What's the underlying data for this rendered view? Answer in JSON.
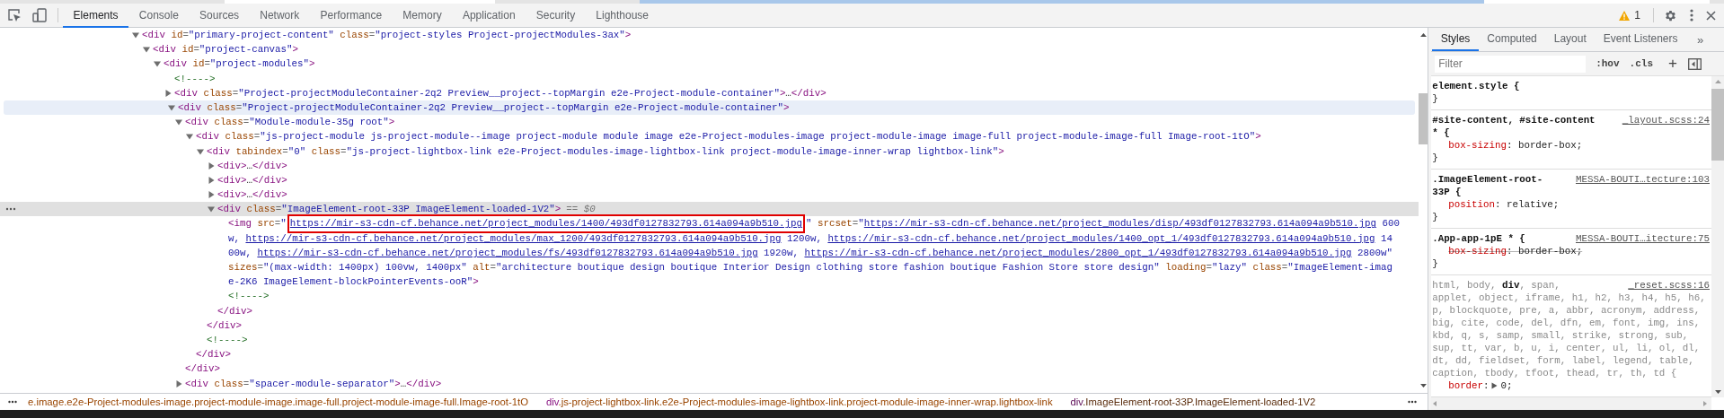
{
  "toolbar": {
    "tabs": [
      {
        "label": "Elements",
        "selected": true
      },
      {
        "label": "Console",
        "selected": false
      },
      {
        "label": "Sources",
        "selected": false
      },
      {
        "label": "Network",
        "selected": false
      },
      {
        "label": "Performance",
        "selected": false
      },
      {
        "label": "Memory",
        "selected": false
      },
      {
        "label": "Application",
        "selected": false
      },
      {
        "label": "Security",
        "selected": false
      },
      {
        "label": "Lighthouse",
        "selected": false
      }
    ],
    "warnings": {
      "count": "1"
    }
  },
  "elements_tree": [
    {
      "kind": "element",
      "expanded": true,
      "selected": false,
      "hovered": false,
      "open": [
        [
          {
            "kind": "tag",
            "text": "<div"
          },
          {
            "kind": "attr",
            "text": " id"
          },
          {
            "kind": "punct",
            "text": "="
          },
          {
            "kind": "value",
            "text": "\"primary-project-content\""
          },
          {
            "kind": "attr",
            "text": " class"
          },
          {
            "kind": "punct",
            "text": "="
          },
          {
            "kind": "value",
            "text": "\"project-styles Project-projectModules-3ax\""
          },
          {
            "kind": "tag",
            "text": ">"
          }
        ]
      ],
      "children": [
        {
          "kind": "element",
          "expanded": true,
          "selected": false,
          "hovered": false,
          "open": [
            [
              {
                "kind": "tag",
                "text": "<div"
              },
              {
                "kind": "attr",
                "text": " id"
              },
              {
                "kind": "punct",
                "text": "="
              },
              {
                "kind": "value",
                "text": "\"project-canvas\""
              },
              {
                "kind": "tag",
                "text": ">"
              }
            ]
          ],
          "children": [
            {
              "kind": "element",
              "expanded": true,
              "selected": false,
              "hovered": false,
              "open": [
                [
                  {
                    "kind": "tag",
                    "text": "<div"
                  },
                  {
                    "kind": "attr",
                    "text": " id"
                  },
                  {
                    "kind": "punct",
                    "text": "="
                  },
                  {
                    "kind": "value",
                    "text": "\"project-modules\""
                  },
                  {
                    "kind": "tag",
                    "text": ">"
                  }
                ]
              ],
              "children": [
                {
                  "kind": "leaf",
                  "selected": false,
                  "hovered": false,
                  "open": [
                    [
                      {
                        "kind": "comment",
                        "text": "<!---->"
                      }
                    ]
                  ]
                },
                {
                  "kind": "element",
                  "expanded": false,
                  "selected": false,
                  "hovered": false,
                  "open": [
                    [
                      {
                        "kind": "tag",
                        "text": "<div"
                      },
                      {
                        "kind": "attr",
                        "text": " class"
                      },
                      {
                        "kind": "punct",
                        "text": "="
                      },
                      {
                        "kind": "value",
                        "text": "\"Project-projectModuleContainer-2q2 Preview__project--topMargin e2e-Project-module-container\""
                      },
                      {
                        "kind": "tag",
                        "text": ">"
                      },
                      {
                        "kind": "text",
                        "text": "…"
                      },
                      {
                        "kind": "tag",
                        "text": "</div>"
                      }
                    ]
                  ]
                },
                {
                  "kind": "element",
                  "expanded": true,
                  "selected": false,
                  "hovered": true,
                  "open": [
                    [
                      {
                        "kind": "tag",
                        "text": "<div"
                      },
                      {
                        "kind": "attr",
                        "text": " class"
                      },
                      {
                        "kind": "punct",
                        "text": "="
                      },
                      {
                        "kind": "value",
                        "text": "\"Project-projectModuleContainer-2q2 Preview__project--topMargin e2e-Project-module-container\""
                      },
                      {
                        "kind": "tag",
                        "text": ">"
                      }
                    ]
                  ],
                  "children": [
                    {
                      "kind": "element",
                      "expanded": true,
                      "selected": false,
                      "hovered": false,
                      "open": [
                        [
                          {
                            "kind": "tag",
                            "text": "<div"
                          },
                          {
                            "kind": "attr",
                            "text": " class"
                          },
                          {
                            "kind": "punct",
                            "text": "="
                          },
                          {
                            "kind": "value",
                            "text": "\"Module-module-35g root\""
                          },
                          {
                            "kind": "tag",
                            "text": ">"
                          }
                        ]
                      ],
                      "close": [
                        {
                          "kind": "tag",
                          "text": "</div>"
                        }
                      ],
                      "children": [
                        {
                          "kind": "element",
                          "expanded": true,
                          "selected": false,
                          "hovered": false,
                          "open": [
                            [
                              {
                                "kind": "tag",
                                "text": "<div"
                              },
                              {
                                "kind": "attr",
                                "text": " class"
                              },
                              {
                                "kind": "punct",
                                "text": "="
                              },
                              {
                                "kind": "value",
                                "text": "\"js-project-module js-project-module--image project-module module image e2e-Project-modules-image project-module-image image-full project-module-image-full Image-root-1tO\""
                              },
                              {
                                "kind": "tag",
                                "text": ">"
                              }
                            ]
                          ],
                          "close": [
                            {
                              "kind": "tag",
                              "text": "</div>"
                            }
                          ],
                          "children": [
                            {
                              "kind": "element",
                              "expanded": true,
                              "selected": false,
                              "hovered": false,
                              "open": [
                                [
                                  {
                                    "kind": "tag",
                                    "text": "<div"
                                  },
                                  {
                                    "kind": "attr",
                                    "text": " tabindex"
                                  },
                                  {
                                    "kind": "punct",
                                    "text": "="
                                  },
                                  {
                                    "kind": "value",
                                    "text": "\"0\""
                                  },
                                  {
                                    "kind": "attr",
                                    "text": " class"
                                  },
                                  {
                                    "kind": "punct",
                                    "text": "="
                                  },
                                  {
                                    "kind": "value",
                                    "text": "\"js-project-lightbox-link e2e-Project-modules-image-lightbox-link project-module-image-inner-wrap lightbox-link\""
                                  },
                                  {
                                    "kind": "tag",
                                    "text": ">"
                                  }
                                ]
                              ],
                              "close": [
                                {
                                  "kind": "tag",
                                  "text": "</div>"
                                }
                              ],
                              "children": [
                                {
                                  "kind": "element",
                                  "expanded": false,
                                  "selected": false,
                                  "hovered": false,
                                  "open": [
                                    [
                                      {
                                        "kind": "tag",
                                        "text": "<div>"
                                      },
                                      {
                                        "kind": "text",
                                        "text": "…"
                                      },
                                      {
                                        "kind": "tag",
                                        "text": "</div>"
                                      }
                                    ]
                                  ]
                                },
                                {
                                  "kind": "element",
                                  "expanded": false,
                                  "selected": false,
                                  "hovered": false,
                                  "open": [
                                    [
                                      {
                                        "kind": "tag",
                                        "text": "<div>"
                                      },
                                      {
                                        "kind": "text",
                                        "text": "…"
                                      },
                                      {
                                        "kind": "tag",
                                        "text": "</div>"
                                      }
                                    ]
                                  ]
                                },
                                {
                                  "kind": "element",
                                  "expanded": false,
                                  "selected": false,
                                  "hovered": false,
                                  "open": [
                                    [
                                      {
                                        "kind": "tag",
                                        "text": "<div>"
                                      },
                                      {
                                        "kind": "text",
                                        "text": "…"
                                      },
                                      {
                                        "kind": "tag",
                                        "text": "</div>"
                                      }
                                    ]
                                  ]
                                },
                                {
                                  "kind": "element",
                                  "expanded": true,
                                  "selected": true,
                                  "hovered": false,
                                  "open": [
                                    [
                                      {
                                        "kind": "tag",
                                        "text": "<div"
                                      },
                                      {
                                        "kind": "attr",
                                        "text": " class"
                                      },
                                      {
                                        "kind": "punct",
                                        "text": "="
                                      },
                                      {
                                        "kind": "value",
                                        "text": "\"ImageElement-root-33P ImageElement-loaded-1V2\""
                                      },
                                      {
                                        "kind": "tag",
                                        "text": ">"
                                      },
                                      {
                                        "kind": "marker",
                                        "text": "== $0"
                                      }
                                    ]
                                  ],
                                  "close": [
                                    {
                                      "kind": "tag",
                                      "text": "</div>"
                                    }
                                  ],
                                  "children": [
                                    {
                                      "kind": "leaf",
                                      "selected": false,
                                      "hovered": false,
                                      "open": [
                                        [
                                          {
                                            "kind": "tag",
                                            "text": "<img"
                                          },
                                          {
                                            "kind": "attr",
                                            "text": " src"
                                          },
                                          {
                                            "kind": "punct",
                                            "text": "="
                                          },
                                          {
                                            "kind": "value",
                                            "text": "\""
                                          },
                                          {
                                            "kind": "link",
                                            "text": "https://mir-s3-cdn-cf.behance.net/project_modules/1400/493df0127832793.614a094a9b510.jpg",
                                            "highlighted": true
                                          },
                                          {
                                            "kind": "value",
                                            "text": "\""
                                          },
                                          {
                                            "kind": "attr",
                                            "text": " srcset"
                                          },
                                          {
                                            "kind": "punct",
                                            "text": "="
                                          },
                                          {
                                            "kind": "value",
                                            "text": "\""
                                          },
                                          {
                                            "kind": "link",
                                            "text": "https://mir-s3-cdn-cf.behance.net/project_modules/disp/493df0127832793.614a094a9b510.jpg",
                                            "highlighted": false
                                          },
                                          {
                                            "kind": "value",
                                            "text": " 600"
                                          }
                                        ],
                                        [
                                          {
                                            "kind": "value",
                                            "text": "w, "
                                          },
                                          {
                                            "kind": "link",
                                            "text": "https://mir-s3-cdn-cf.behance.net/project_modules/max_1200/493df0127832793.614a094a9b510.jpg",
                                            "highlighted": false
                                          },
                                          {
                                            "kind": "value",
                                            "text": " 1200w, "
                                          },
                                          {
                                            "kind": "link",
                                            "text": "https://mir-s3-cdn-cf.behance.net/project_modules/1400_opt_1/493df0127832793.614a094a9b510.jpg",
                                            "highlighted": false
                                          },
                                          {
                                            "kind": "value",
                                            "text": " 14"
                                          }
                                        ],
                                        [
                                          {
                                            "kind": "value",
                                            "text": "00w, "
                                          },
                                          {
                                            "kind": "link",
                                            "text": "https://mir-s3-cdn-cf.behance.net/project_modules/fs/493df0127832793.614a094a9b510.jpg",
                                            "highlighted": false
                                          },
                                          {
                                            "kind": "value",
                                            "text": " 1920w, "
                                          },
                                          {
                                            "kind": "link",
                                            "text": "https://mir-s3-cdn-cf.behance.net/project_modules/2800_opt_1/493df0127832793.614a094a9b510.jpg",
                                            "highlighted": false
                                          },
                                          {
                                            "kind": "value",
                                            "text": " 2800w\""
                                          }
                                        ],
                                        [
                                          {
                                            "kind": "attr",
                                            "text": "sizes"
                                          },
                                          {
                                            "kind": "punct",
                                            "text": "="
                                          },
                                          {
                                            "kind": "value",
                                            "text": "\"(max-width: 1400px) 100vw, 1400px\""
                                          },
                                          {
                                            "kind": "attr",
                                            "text": " alt"
                                          },
                                          {
                                            "kind": "punct",
                                            "text": "="
                                          },
                                          {
                                            "kind": "value",
                                            "text": "\"architecture boutique design boutique Interior Design clothing store fashion boutique Fashion Store store design\""
                                          },
                                          {
                                            "kind": "attr",
                                            "text": " loading"
                                          },
                                          {
                                            "kind": "punct",
                                            "text": "="
                                          },
                                          {
                                            "kind": "value",
                                            "text": "\"lazy\""
                                          },
                                          {
                                            "kind": "attr",
                                            "text": " class"
                                          },
                                          {
                                            "kind": "punct",
                                            "text": "="
                                          },
                                          {
                                            "kind": "value",
                                            "text": "\"ImageElement-imag"
                                          }
                                        ],
                                        [
                                          {
                                            "kind": "value",
                                            "text": "e-2K6 ImageElement-blockPointerEvents-ooR\""
                                          },
                                          {
                                            "kind": "tag",
                                            "text": ">"
                                          }
                                        ]
                                      ]
                                    },
                                    {
                                      "kind": "leaf",
                                      "selected": false,
                                      "hovered": false,
                                      "open": [
                                        [
                                          {
                                            "kind": "comment",
                                            "text": "<!---->"
                                          }
                                        ]
                                      ]
                                    }
                                  ]
                                }
                              ]
                            },
                            {
                              "kind": "leaf",
                              "selected": false,
                              "hovered": false,
                              "open": [
                                [
                                  {
                                    "kind": "comment",
                                    "text": "<!---->"
                                  }
                                ]
                              ]
                            }
                          ]
                        }
                      ]
                    },
                    {
                      "kind": "element",
                      "expanded": false,
                      "selected": false,
                      "hovered": false,
                      "open": [
                        [
                          {
                            "kind": "tag",
                            "text": "<div"
                          },
                          {
                            "kind": "attr",
                            "text": " class"
                          },
                          {
                            "kind": "punct",
                            "text": "="
                          },
                          {
                            "kind": "value",
                            "text": "\"spacer-module-separator\""
                          },
                          {
                            "kind": "tag",
                            "text": ">"
                          },
                          {
                            "kind": "text",
                            "text": "…"
                          },
                          {
                            "kind": "tag",
                            "text": "</div>"
                          }
                        ]
                      ]
                    }
                  ]
                }
              ]
            }
          ]
        }
      ]
    }
  ],
  "breadcrumbs": [
    {
      "classes": "e.image.e2e-Project-modules-image.project-module-image.image-full.project-module-image-full.Image-root-1tO",
      "selected": false
    },
    {
      "tag": "div",
      "classes": ".js-project-lightbox-link.e2e-Project-modules-image-lightbox-link.project-module-image-inner-wrap.lightbox-link",
      "selected": false
    },
    {
      "tag": "div",
      "classes": ".ImageElement-root-33P.ImageElement-loaded-1V2",
      "selected": true
    }
  ],
  "styles_panel": {
    "tabs": [
      {
        "label": "Styles",
        "selected": true
      },
      {
        "label": "Computed",
        "selected": false
      },
      {
        "label": "Layout",
        "selected": false
      },
      {
        "label": "Event Listeners",
        "selected": false
      }
    ],
    "more_tabs": "»",
    "filter": {
      "placeholder": "Filter"
    },
    "hov": ":hov",
    "cls": ".cls",
    "add": "+",
    "rules": [
      {
        "selector": [
          [
            {
              "text": "element.style {",
              "matched": true
            }
          ]
        ],
        "close": "}"
      },
      {
        "selector": [
          [
            {
              "text": "#site-content, #site-content",
              "matched": true
            }
          ],
          [
            {
              "text": "* {",
              "matched": true
            }
          ]
        ],
        "source": "_layout.scss:24",
        "properties": [
          {
            "kind": "plain",
            "name": "box-sizing",
            "sep": ": ",
            "value": "border-box;",
            "overridden": false
          }
        ],
        "close": "}"
      },
      {
        "selector": [
          [
            {
              "text": ".ImageElement-root-",
              "matched": true
            }
          ],
          [
            {
              "text": "33P {",
              "matched": true
            }
          ]
        ],
        "source": "MESSA-BOUTI…tecture:103",
        "properties": [
          {
            "kind": "plain",
            "name": "position",
            "sep": ": ",
            "value": "relative;",
            "overridden": false
          }
        ],
        "close": "}"
      },
      {
        "selector": [
          [
            {
              "text": ".App-app-1pE * {",
              "matched": true
            }
          ]
        ],
        "source": "MESSA-BOUTI…itecture:75",
        "properties": [
          {
            "kind": "plain",
            "name": "box-sizing",
            "sep": ": ",
            "value": "border-box;",
            "overridden": true
          }
        ],
        "close": "}"
      },
      {
        "selector": [
          [
            {
              "text": "html, body, ",
              "matched": false
            },
            {
              "text": "div",
              "matched": true
            },
            {
              "text": ", span,",
              "matched": false
            }
          ],
          [
            {
              "text": "applet, object, iframe, h1, h2, h3, h4, h5, h6, p, blockquote, pre, a, abbr, acronym, address, big, cite, code, del, dfn, em, font, img, ins, kbd, q, s, samp, small, strike, strong, sub, sup, tt, var, b, u, i, center, ul, li, ol, dl, dt, dd, fieldset, form, label, legend, table, caption, tbody, tfoot, thead, tr, th, td {",
              "matched": false
            }
          ]
        ],
        "source": "_reset.scss:16",
        "properties": [
          {
            "kind": "shorthand",
            "name": "border",
            "sep": ": ",
            "value": "0;",
            "overridden": false,
            "expanded": false
          }
        ]
      }
    ]
  }
}
